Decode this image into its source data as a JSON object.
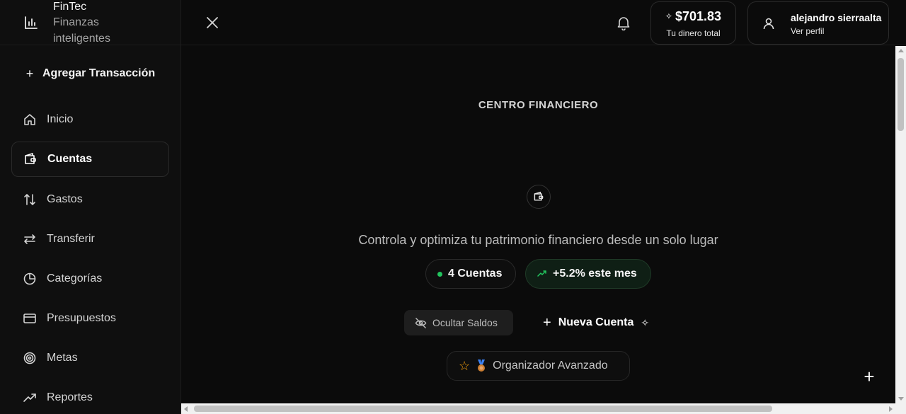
{
  "brand": {
    "name": "FinTec",
    "subtitle": "Finanzas inteligentes",
    "icon": "bar-chart-icon"
  },
  "sidebar": {
    "add_transaction": "Agregar Transacción",
    "items": [
      {
        "label": "Inicio",
        "icon": "home-icon",
        "active": false
      },
      {
        "label": "Cuentas",
        "icon": "wallet-icon",
        "active": true
      },
      {
        "label": "Gastos",
        "icon": "arrows-up-down-icon",
        "active": false
      },
      {
        "label": "Transferir",
        "icon": "arrows-left-right-icon",
        "active": false
      },
      {
        "label": "Categorías",
        "icon": "pie-chart-icon",
        "active": false
      },
      {
        "label": "Presupuestos",
        "icon": "credit-card-icon",
        "active": false
      },
      {
        "label": "Metas",
        "icon": "target-icon",
        "active": false
      },
      {
        "label": "Reportes",
        "icon": "trending-up-icon",
        "active": false
      }
    ]
  },
  "header": {
    "balance_amount": "$701.83",
    "balance_caption": "Tu dinero total",
    "user_name": "alejandro sierraalta",
    "user_link": "Ver perfil"
  },
  "main": {
    "section_title": "CENTRO FINANCIERO",
    "tagline": "Controla y optimiza tu patrimonio financiero desde un solo lugar",
    "accounts_pill": "4 Cuentas",
    "growth_pill": "+5.2% este mes",
    "hide_balances": "Ocultar Saldos",
    "new_account": "Nueva Cuenta",
    "rank": "Organizador Avanzado"
  },
  "colors": {
    "background": "#0b0b0b",
    "accent_green": "#22c55e",
    "star": "#f59e0b"
  }
}
